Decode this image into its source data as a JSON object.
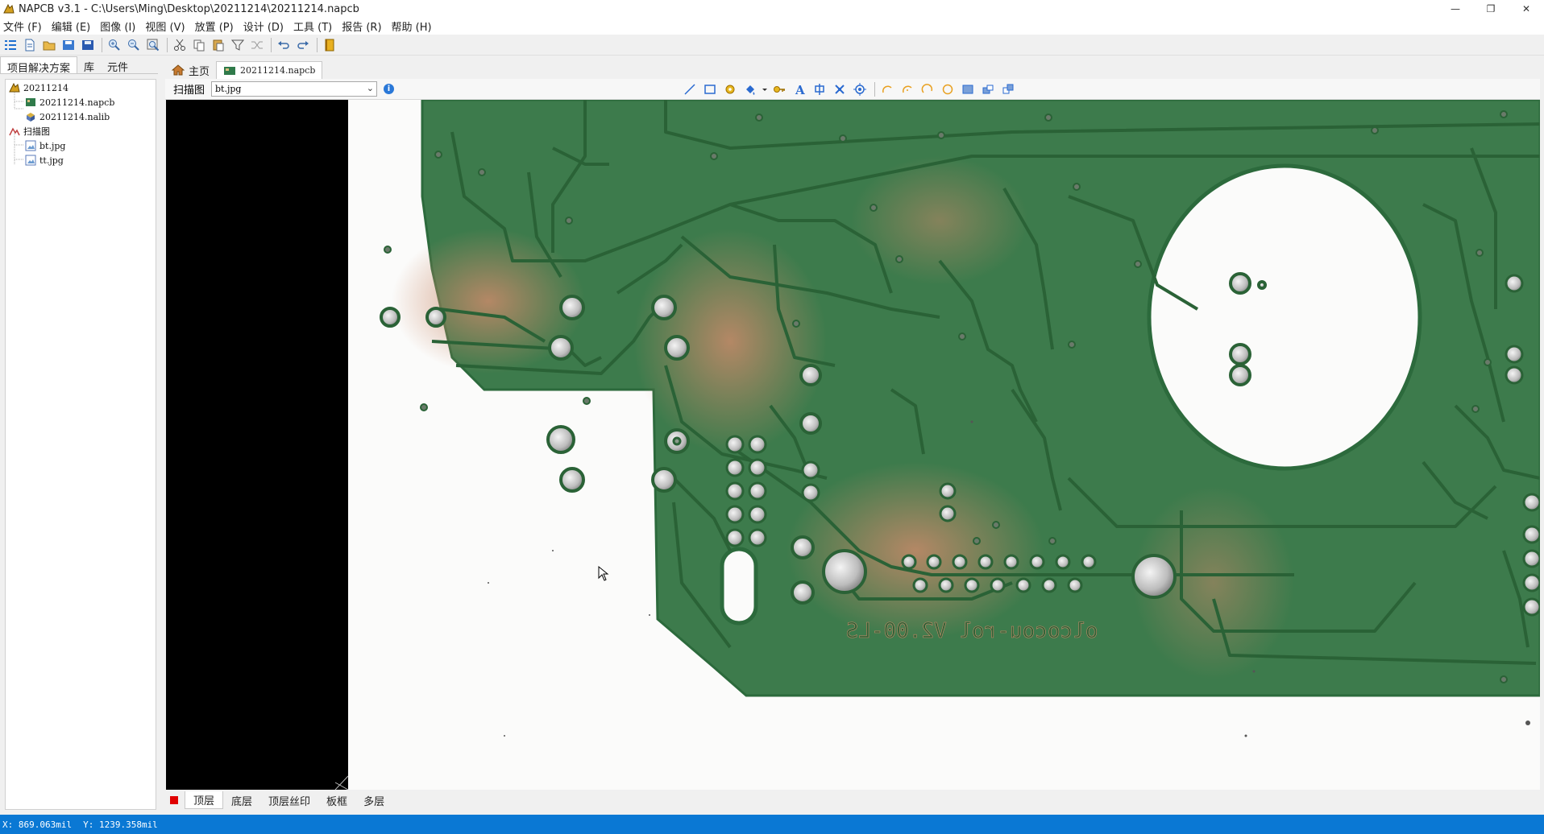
{
  "window": {
    "title": "NAPCB v3.1 - C:\\Users\\Ming\\Desktop\\20211214\\20211214.napcb",
    "controls": [
      "minimize",
      "restore",
      "close"
    ]
  },
  "menu": [
    {
      "label": "文件 (F)"
    },
    {
      "label": "编辑 (E)"
    },
    {
      "label": "图像 (I)"
    },
    {
      "label": "视图 (V)"
    },
    {
      "label": "放置 (P)"
    },
    {
      "label": "设计 (D)"
    },
    {
      "label": "工具 (T)"
    },
    {
      "label": "报告 (R)"
    },
    {
      "label": "帮助 (H)"
    }
  ],
  "toolbar_icons": [
    "list-icon",
    "new-file-icon",
    "open-folder-icon",
    "save-image-icon",
    "save-icon",
    "zoom-in-icon",
    "zoom-out-icon",
    "zoom-fit-icon",
    "cut-icon",
    "copy-icon",
    "paste-icon",
    "filter-icon",
    "shuffle-icon",
    "undo-icon",
    "redo-icon",
    "book-icon"
  ],
  "left_panel": {
    "tabs": [
      {
        "label": "项目解决方案",
        "active": true
      },
      {
        "label": "库"
      },
      {
        "label": "元件"
      }
    ],
    "tree": {
      "project": "20211214",
      "project_files": [
        "20211214.napcb",
        "20211214.nalib"
      ],
      "scans_folder": "扫描图",
      "scans": [
        "bt.jpg",
        "tt.jpg"
      ]
    }
  },
  "doc_tabs": {
    "home": "主页",
    "active_file": "20211214.napcb"
  },
  "subbar": {
    "label": "扫描图",
    "selected_image": "bt.jpg"
  },
  "draw_tool_icons": [
    "line-icon",
    "rectangle-icon",
    "pad-icon",
    "fill-icon",
    "dropdown-arrow-icon",
    "key-icon",
    "text-icon",
    "center-icon",
    "component-icon",
    "target-icon",
    "arc-icon-1",
    "arc-icon-2",
    "arc-icon-3",
    "circle-icon",
    "solid-rect-icon",
    "align-icon",
    "group-icon"
  ],
  "layer_tabs": [
    {
      "label": "顶层",
      "active": true
    },
    {
      "label": "底层"
    },
    {
      "label": "顶层丝印"
    },
    {
      "label": "板框"
    },
    {
      "label": "多层"
    }
  ],
  "pcb_silkscreen": "olcocou-rol V2.00-LS",
  "status": {
    "x": "X: 869.063mil",
    "y": "Y: 1239.358mil"
  },
  "colors": {
    "status_bar": "#0a78d4",
    "pcb_green": "#3a7a48",
    "copper": "#c98a6a",
    "active_layer": "#e00000"
  }
}
